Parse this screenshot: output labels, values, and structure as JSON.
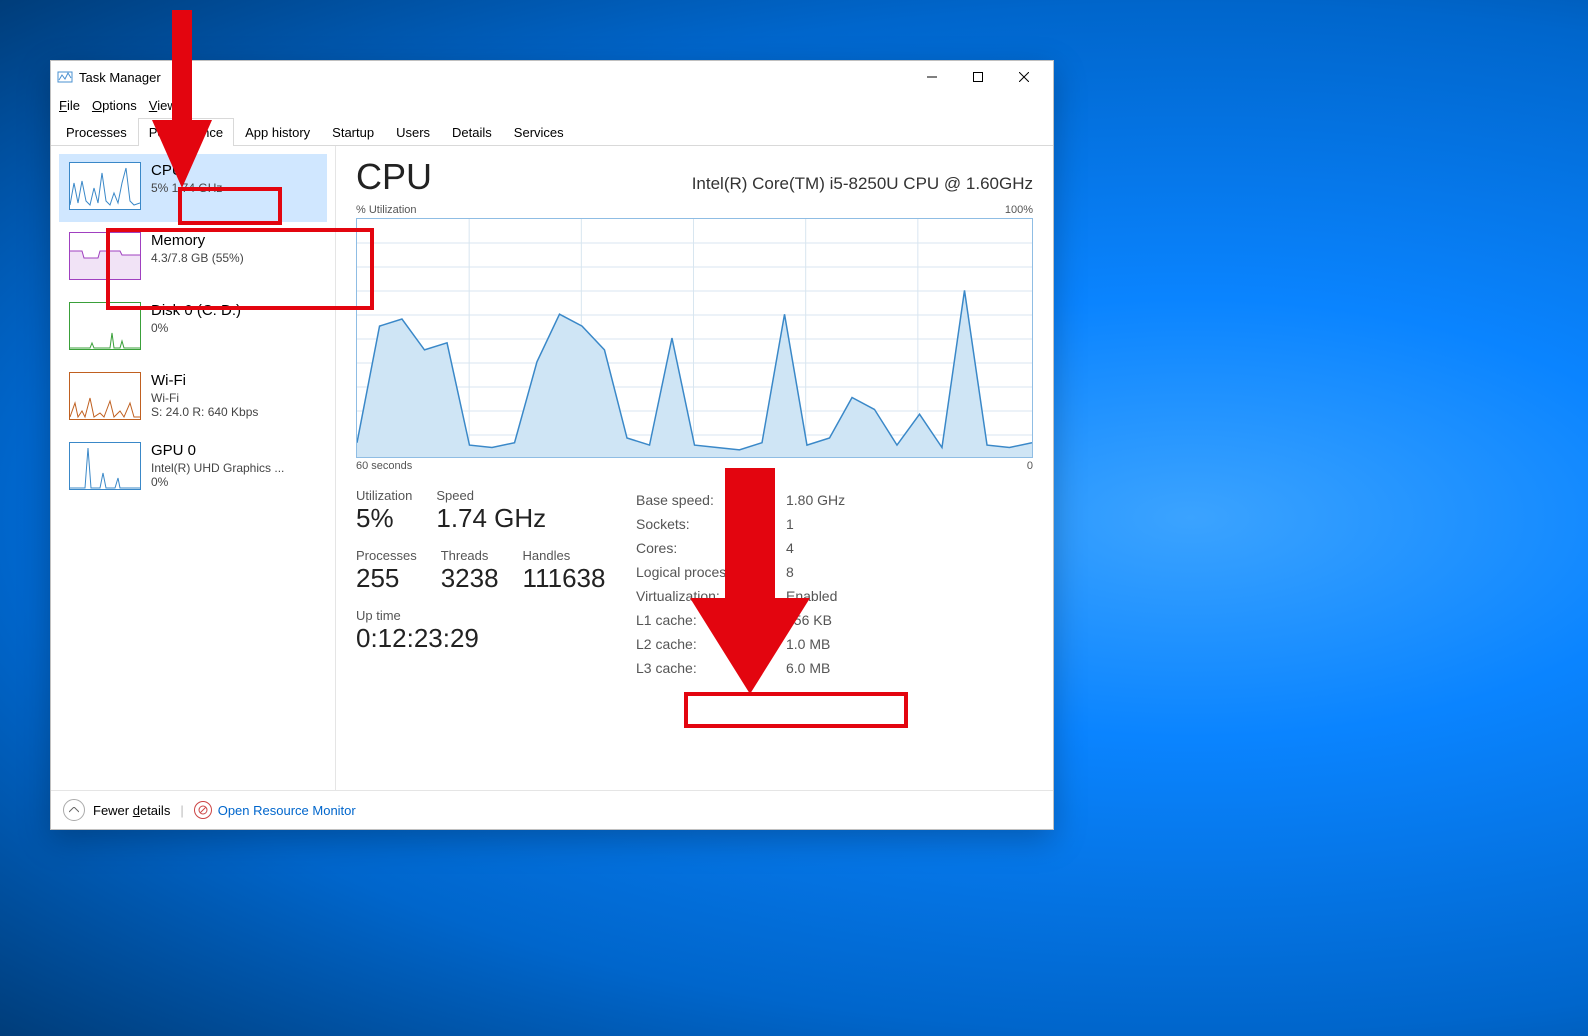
{
  "window": {
    "title": "Task Manager"
  },
  "menu": {
    "file": "File",
    "options": "Options",
    "view": "View"
  },
  "tabs": [
    "Processes",
    "Performance",
    "App history",
    "Startup",
    "Users",
    "Details",
    "Services"
  ],
  "sidebar": [
    {
      "name": "CPU",
      "sub1": "5%  1.74 GHz",
      "sub2": "",
      "color": "#3a88c8",
      "selected": true
    },
    {
      "name": "Memory",
      "sub1": "4.3/7.8 GB (55%)",
      "sub2": "",
      "color": "#a040c0",
      "selected": false
    },
    {
      "name": "Disk 0 (C: D:)",
      "sub1": "0%",
      "sub2": "",
      "color": "#3aa03a",
      "selected": false
    },
    {
      "name": "Wi-Fi",
      "sub1": "Wi-Fi",
      "sub2": "S: 24.0  R: 640 Kbps",
      "color": "#c06020",
      "selected": false
    },
    {
      "name": "GPU 0",
      "sub1": "Intel(R) UHD Graphics ...",
      "sub2": "0%",
      "color": "#3a88c8",
      "selected": false
    }
  ],
  "cpu": {
    "title": "CPU",
    "chip": "Intel(R) Core(TM) i5-8250U CPU @ 1.60GHz",
    "chart_top_left": "% Utilization",
    "chart_top_right": "100%",
    "chart_bottom_left": "60 seconds",
    "chart_bottom_right": "0",
    "stats": {
      "utilization_label": "Utilization",
      "utilization_value": "5%",
      "speed_label": "Speed",
      "speed_value": "1.74 GHz",
      "processes_label": "Processes",
      "processes_value": "255",
      "threads_label": "Threads",
      "threads_value": "3238",
      "handles_label": "Handles",
      "handles_value": "111638",
      "uptime_label": "Up time",
      "uptime_value": "0:12:23:29"
    },
    "specs": [
      {
        "k": "Base speed:",
        "v": "1.80 GHz"
      },
      {
        "k": "Sockets:",
        "v": "1"
      },
      {
        "k": "Cores:",
        "v": "4"
      },
      {
        "k": "Logical processors:",
        "v": "8"
      },
      {
        "k": "Virtualization:",
        "v": "Enabled"
      },
      {
        "k": "L1 cache:",
        "v": "256 KB"
      },
      {
        "k": "L2 cache:",
        "v": "1.0 MB"
      },
      {
        "k": "L3 cache:",
        "v": "6.0 MB"
      }
    ]
  },
  "footer": {
    "fewer": "Fewer details",
    "open_rm": "Open Resource Monitor"
  },
  "chart_data": {
    "type": "line",
    "title": "% Utilization",
    "xlabel": "60 seconds",
    "ylabel": "% Utilization",
    "ylim": [
      0,
      100
    ],
    "xlim": [
      60,
      0
    ],
    "x": [
      60,
      58,
      56,
      54,
      52,
      50,
      48,
      46,
      44,
      42,
      40,
      38,
      36,
      34,
      32,
      30,
      28,
      26,
      24,
      22,
      20,
      18,
      16,
      14,
      12,
      10,
      8,
      6,
      4,
      2,
      0
    ],
    "values": [
      6,
      55,
      58,
      45,
      48,
      5,
      4,
      6,
      40,
      60,
      55,
      45,
      8,
      5,
      50,
      5,
      4,
      3,
      6,
      60,
      5,
      8,
      25,
      20,
      5,
      18,
      4,
      70,
      5,
      4,
      6
    ]
  }
}
